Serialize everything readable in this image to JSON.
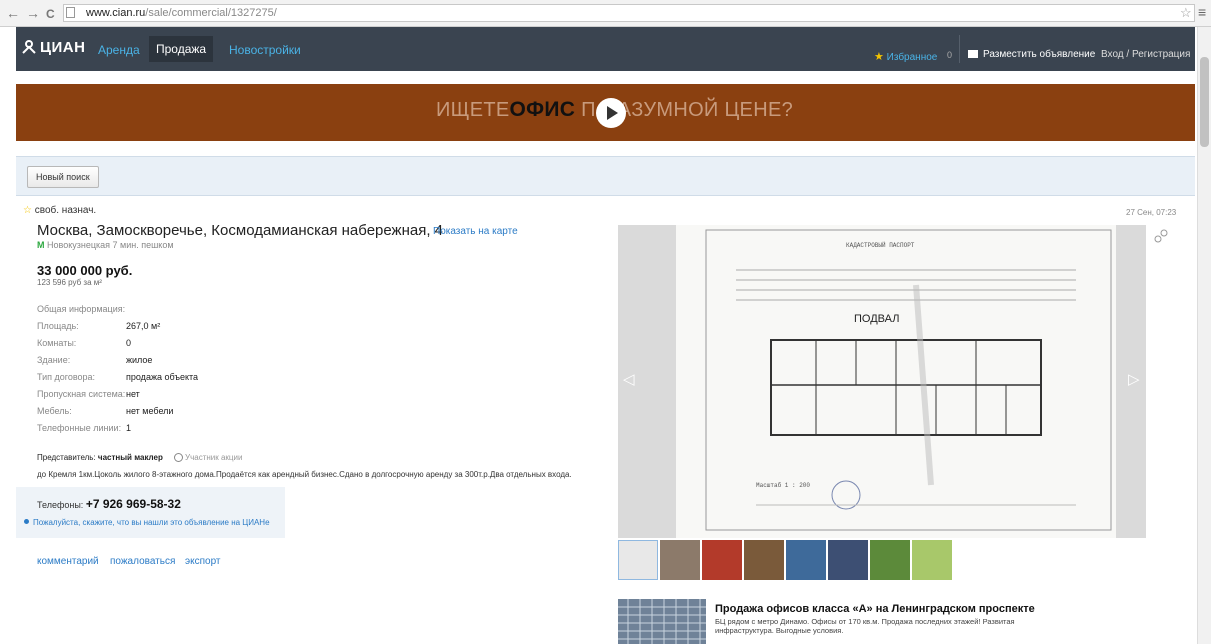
{
  "browser": {
    "back": "←",
    "forward": "→",
    "reload": "C",
    "url_domain": "www.cian.ru",
    "url_path": "/sale/commercial/1327275/",
    "star": "☆",
    "menu": "≡"
  },
  "header": {
    "logo": "ЦИАН",
    "nav": [
      "Аренда",
      "Продажа",
      "Новостройки"
    ],
    "favorites": "Избранное",
    "favorites_count": "0",
    "post_ad": "Разместить объявление",
    "login": "Вход / Регистрация"
  },
  "banner": {
    "pre": "ИЩЕТЕ",
    "bold": "ОФИС",
    "mid": " П",
    "post": "АЗУМНОЙ ЦЕНЕ?"
  },
  "search": {
    "new_search": "Новый поиск"
  },
  "listing": {
    "type": "своб. назнач.",
    "date": "27 Сен, 07:23",
    "address": "Москва, Замоскворечье, Космодамианская набережная, 4",
    "map_link": "Показать на карте",
    "metro_letter": "М",
    "metro": "Новокузнецкая 7 мин. пешком",
    "price": "33 000 000 руб.",
    "price_per_m2": "123 596 руб за м²",
    "info_header": "Общая информация:",
    "rows": [
      {
        "k": "Площадь:",
        "v": "267,0 м²"
      },
      {
        "k": "Комнаты:",
        "v": "0"
      },
      {
        "k": "Здание:",
        "v": "жилое"
      },
      {
        "k": "Тип договора:",
        "v": "продажа объекта"
      },
      {
        "k": "Пропускная система:",
        "v": "нет"
      },
      {
        "k": "Мебель:",
        "v": "нет мебели"
      },
      {
        "k": "Телефонные линии:",
        "v": "1"
      }
    ],
    "agent_label": "Представитель: ",
    "agent_value": "частный маклер",
    "promo": "Участник акции",
    "description": "до Кремля 1км.Цоколь жилого 8-этажного дома.Продаётся как арендный бизнес.Сдано в долгосрочную аренду за 300т.р.Два отдельных входа.",
    "phone_label": "Телефоны: ",
    "phone": "+7 926 969-58-32",
    "phone_note": "Пожалуйста, скажите, что вы нашли это объявление на ЦИАНе",
    "links": [
      "комментарий",
      "пожаловаться",
      "экспорт"
    ]
  },
  "gallery": {
    "doc_title": "ПОДВАЛ",
    "doc_header": "КАДАСТРОВЫЙ ПАСПОРТ",
    "scale": "Масштаб 1 : 200",
    "thumb_colors": [
      "#e8e8e8",
      "#8c7a6a",
      "#b33a2a",
      "#7a5a3a",
      "#3e6a9a",
      "#3d4f73",
      "#5c8a3a",
      "#a8c86a"
    ]
  },
  "ad": {
    "title": "Продажа офисов класса «А» на Ленинградском проспекте",
    "desc": "БЦ рядом с метро Динамо. Офисы от 170 кв.м. Продажа последних этажей! Развитая инфраструктура. Выгодные условия."
  }
}
